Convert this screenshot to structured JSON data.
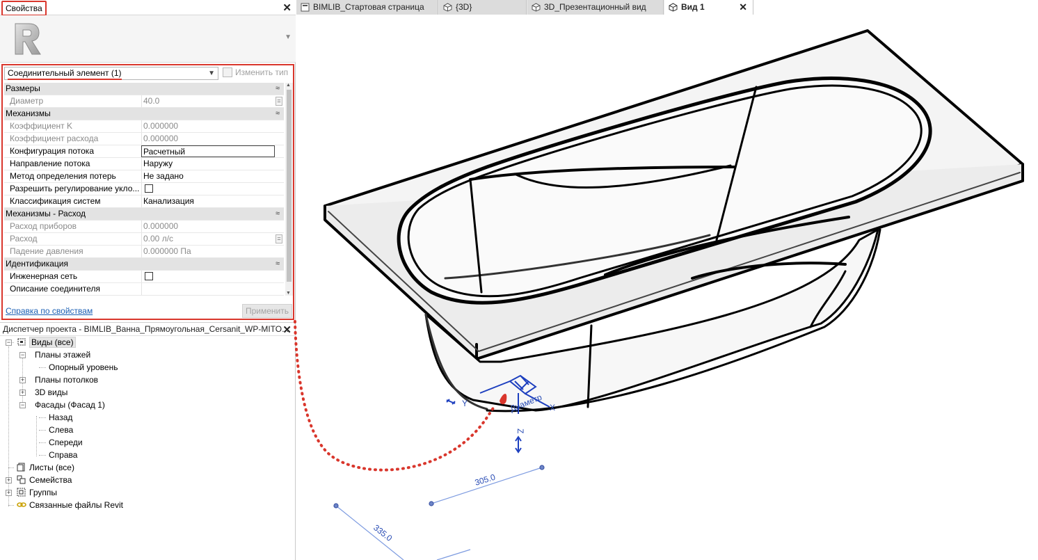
{
  "properties": {
    "title": "Свойства",
    "type_selector": "Соединительный элемент (1)",
    "edit_type_label": "Изменить тип",
    "groups": [
      {
        "name": "Размеры",
        "rows": [
          {
            "name": "Диаметр",
            "value": "40.0",
            "dim": true,
            "assoc": true
          }
        ]
      },
      {
        "name": "Механизмы",
        "rows": [
          {
            "name": "Коэффициент K",
            "value": "0.000000",
            "dim": true
          },
          {
            "name": "Коэффициент расхода",
            "value": "0.000000",
            "dim": true
          },
          {
            "name": "Конфигурация потока",
            "value": "Расчетный",
            "boxed": true
          },
          {
            "name": "Направление потока",
            "value": "Наружу"
          },
          {
            "name": "Метод определения потерь",
            "value": "Не задано"
          },
          {
            "name": "Разрешить регулирование укло...",
            "value": "",
            "checkbox": true
          },
          {
            "name": "Классификация систем",
            "value": "Канализация"
          }
        ]
      },
      {
        "name": "Механизмы - Расход",
        "rows": [
          {
            "name": "Расход приборов",
            "value": "0.000000",
            "dim": true
          },
          {
            "name": "Расход",
            "value": "0.00 л/с",
            "dim": true,
            "assoc": true
          },
          {
            "name": "Падение давления",
            "value": "0.000000 Па",
            "dim": true
          }
        ]
      },
      {
        "name": "Идентификация",
        "rows": [
          {
            "name": "Инженерная сеть",
            "value": "",
            "checkbox": true
          },
          {
            "name": "Описание соединителя",
            "value": ""
          }
        ]
      }
    ],
    "help_link": "Справка по свойствам",
    "apply_label": "Применить"
  },
  "project_browser": {
    "title": "Диспетчер проекта - BIMLIB_Ванна_Прямоугольная_Cersanit_WP-MITO...",
    "nodes": {
      "views_all": "Виды (все)",
      "floor_plans": "Планы этажей",
      "ref_level": "Опорный уровень",
      "ceiling_plans": "Планы потолков",
      "views_3d": "3D виды",
      "facades": "Фасады (Фасад 1)",
      "back": "Назад",
      "left": "Слева",
      "front": "Спереди",
      "right": "Справа",
      "sheets": "Листы (все)",
      "families": "Семейства",
      "groups": "Группы",
      "links": "Связанные файлы Revit"
    }
  },
  "tabs": [
    {
      "label": "BIMLIB_Стартовая страница",
      "icon": "revit-page-icon"
    },
    {
      "label": "{3D}",
      "icon": "3d-cube-icon"
    },
    {
      "label": "3D_Презентационный вид",
      "icon": "3d-cube-icon"
    },
    {
      "label": "Вид 1",
      "icon": "3d-cube-icon",
      "active": true
    }
  ],
  "viewport": {
    "connector_label": "Диаметр",
    "axis_labels": [
      "Y",
      "X",
      "Z"
    ],
    "dimension_1": "305.0",
    "dimension_2": "335.0"
  },
  "colors": {
    "highlight": "#d9362c",
    "dimension": "#2a4db5",
    "connector": "#1d3fbf"
  }
}
